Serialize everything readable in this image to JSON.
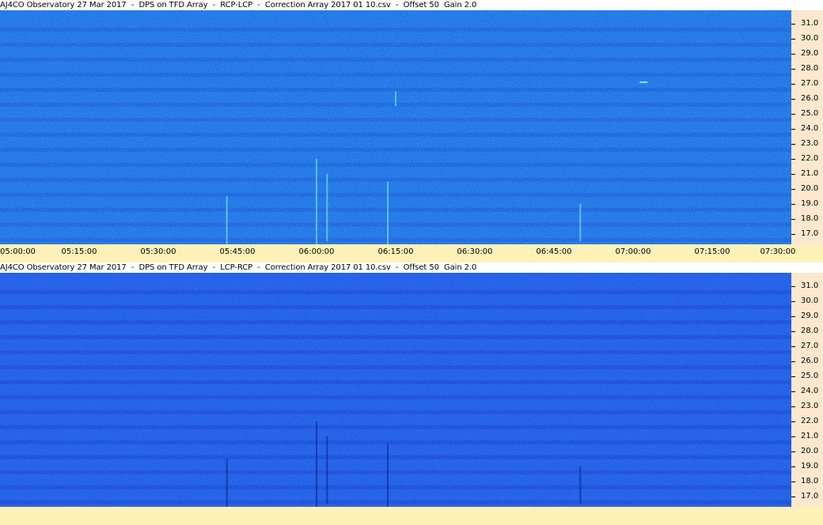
{
  "panels": [
    {
      "title": "AJ4CO Observatory 27 Mar 2017  -  DPS on TFD Array  -  RCP-LCP  -  Correction Array 2017 01 10.csv  -  Offset 50  Gain 2.0",
      "polarity": "RCP-LCP",
      "base_color": "#1c73e6",
      "band_color": "#1858d6",
      "burst_color": "#7ff0f0",
      "show_x_labels": true
    },
    {
      "title": "AJ4CO Observatory 27 Mar 2017  -  DPS on TFD Array  -  LCP-RCP  -  Correction Array 2017 01 10.csv  -  Offset 50  Gain 2.0",
      "polarity": "LCP-RCP",
      "base_color": "#1f5ee8",
      "band_color": "#1a45c8",
      "burst_color": "#0a2290",
      "show_x_labels": false
    }
  ],
  "chart_data": [
    {
      "type": "heatmap",
      "title": "AJ4CO Observatory 27 Mar 2017  -  DPS on TFD Array  -  RCP-LCP  -  Correction Array 2017 01 10.csv  -  Offset 50  Gain 2.0",
      "xlabel": "",
      "ylabel": "",
      "x_ticks": [
        "05:00:00",
        "05:15:00",
        "05:30:00",
        "05:45:00",
        "06:00:00",
        "06:15:00",
        "06:30:00",
        "06:45:00",
        "07:00:00",
        "07:15:00",
        "07:30:00"
      ],
      "y_ticks": [
        31.0,
        30.0,
        29.0,
        28.0,
        27.0,
        26.0,
        25.0,
        24.0,
        23.0,
        22.0,
        21.0,
        20.0,
        19.0,
        18.0,
        17.0
      ],
      "xlim": [
        "05:00:00",
        "07:30:00"
      ],
      "ylim": [
        16.3,
        31.9
      ],
      "features": [
        {
          "kind": "burst",
          "time": "05:43:00",
          "freq_low": 16.3,
          "freq_high": 19.5
        },
        {
          "kind": "burst",
          "time": "06:00:00",
          "freq_low": 16.3,
          "freq_high": 22.0
        },
        {
          "kind": "burst",
          "time": "06:02:00",
          "freq_low": 16.5,
          "freq_high": 21.0
        },
        {
          "kind": "burst",
          "time": "06:13:30",
          "freq_low": 16.3,
          "freq_high": 20.5
        },
        {
          "kind": "burst",
          "time": "06:15:00",
          "freq_low": 25.5,
          "freq_high": 26.5
        },
        {
          "kind": "burst",
          "time": "06:50:00",
          "freq_low": 16.5,
          "freq_high": 19.0
        },
        {
          "kind": "interference",
          "time": "07:02:00",
          "freq_low": 27.0,
          "freq_high": 27.1
        }
      ],
      "grid": false,
      "legend": "none"
    },
    {
      "type": "heatmap",
      "title": "AJ4CO Observatory 27 Mar 2017  -  DPS on TFD Array  -  LCP-RCP  -  Correction Array 2017 01 10.csv  -  Offset 50  Gain 2.0",
      "xlabel": "",
      "ylabel": "",
      "x_ticks": [],
      "y_ticks": [
        31.0,
        30.0,
        29.0,
        28.0,
        27.0,
        26.0,
        25.0,
        24.0,
        23.0,
        22.0,
        21.0,
        20.0,
        19.0,
        18.0,
        17.0
      ],
      "xlim": [
        "05:00:00",
        "07:30:00"
      ],
      "ylim": [
        16.3,
        31.9
      ],
      "features": [
        {
          "kind": "burst",
          "time": "05:43:00",
          "freq_low": 16.3,
          "freq_high": 19.5
        },
        {
          "kind": "burst",
          "time": "06:00:00",
          "freq_low": 16.3,
          "freq_high": 22.0
        },
        {
          "kind": "burst",
          "time": "06:02:00",
          "freq_low": 16.5,
          "freq_high": 21.0
        },
        {
          "kind": "burst",
          "time": "06:13:30",
          "freq_low": 16.3,
          "freq_high": 20.5
        },
        {
          "kind": "burst",
          "time": "06:50:00",
          "freq_low": 16.5,
          "freq_high": 19.0
        }
      ],
      "grid": false,
      "legend": "none"
    }
  ]
}
